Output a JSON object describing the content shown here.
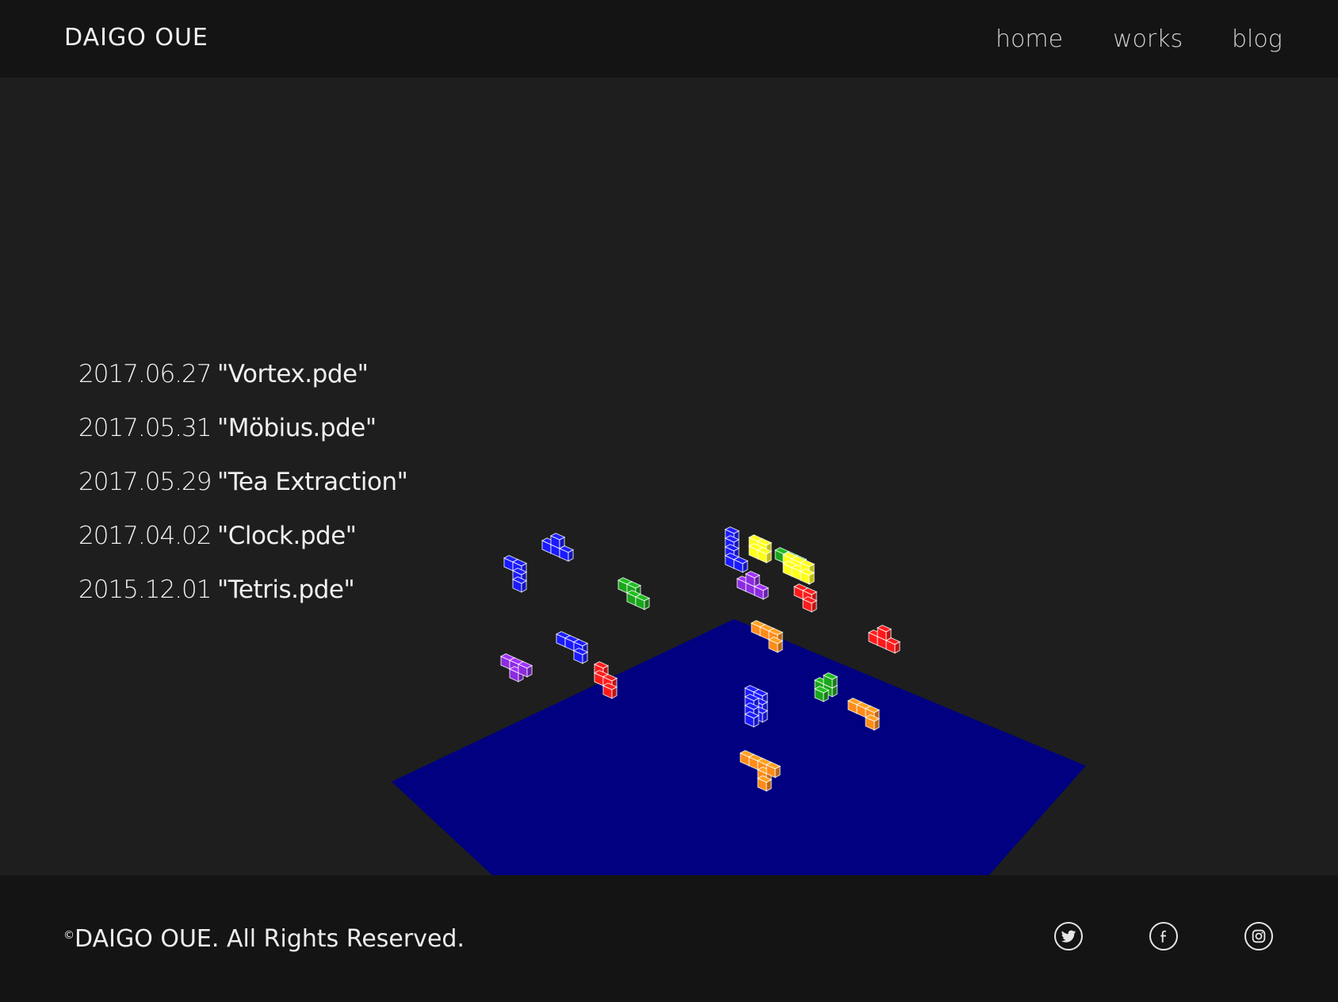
{
  "header": {
    "logo": "DAIGO OUE",
    "nav": [
      "home",
      "works",
      "blog"
    ]
  },
  "posts": [
    {
      "date": "2017.06.27",
      "title": "\"Vortex.pde\""
    },
    {
      "date": "2017.05.31",
      "title": "\"Möbius.pde\""
    },
    {
      "date": "2017.05.29",
      "title": "\"Tea Extraction\""
    },
    {
      "date": "2017.04.02",
      "title": "\"Clock.pde\""
    },
    {
      "date": "2015.12.01",
      "title": "\"Tetris.pde\""
    }
  ],
  "scene": {
    "floor_color": "#000080",
    "block_colors": [
      "#1a1aff",
      "#ff1a1a",
      "#ff8c1a",
      "#1aa61a",
      "#ffff1a",
      "#8c2be0"
    ]
  },
  "footer": {
    "copyright_mark": "©",
    "copyright_text": "DAIGO OUE. All Rights Reserved.",
    "social_icons": [
      "twitter-icon",
      "facebook-icon",
      "instagram-icon"
    ]
  }
}
